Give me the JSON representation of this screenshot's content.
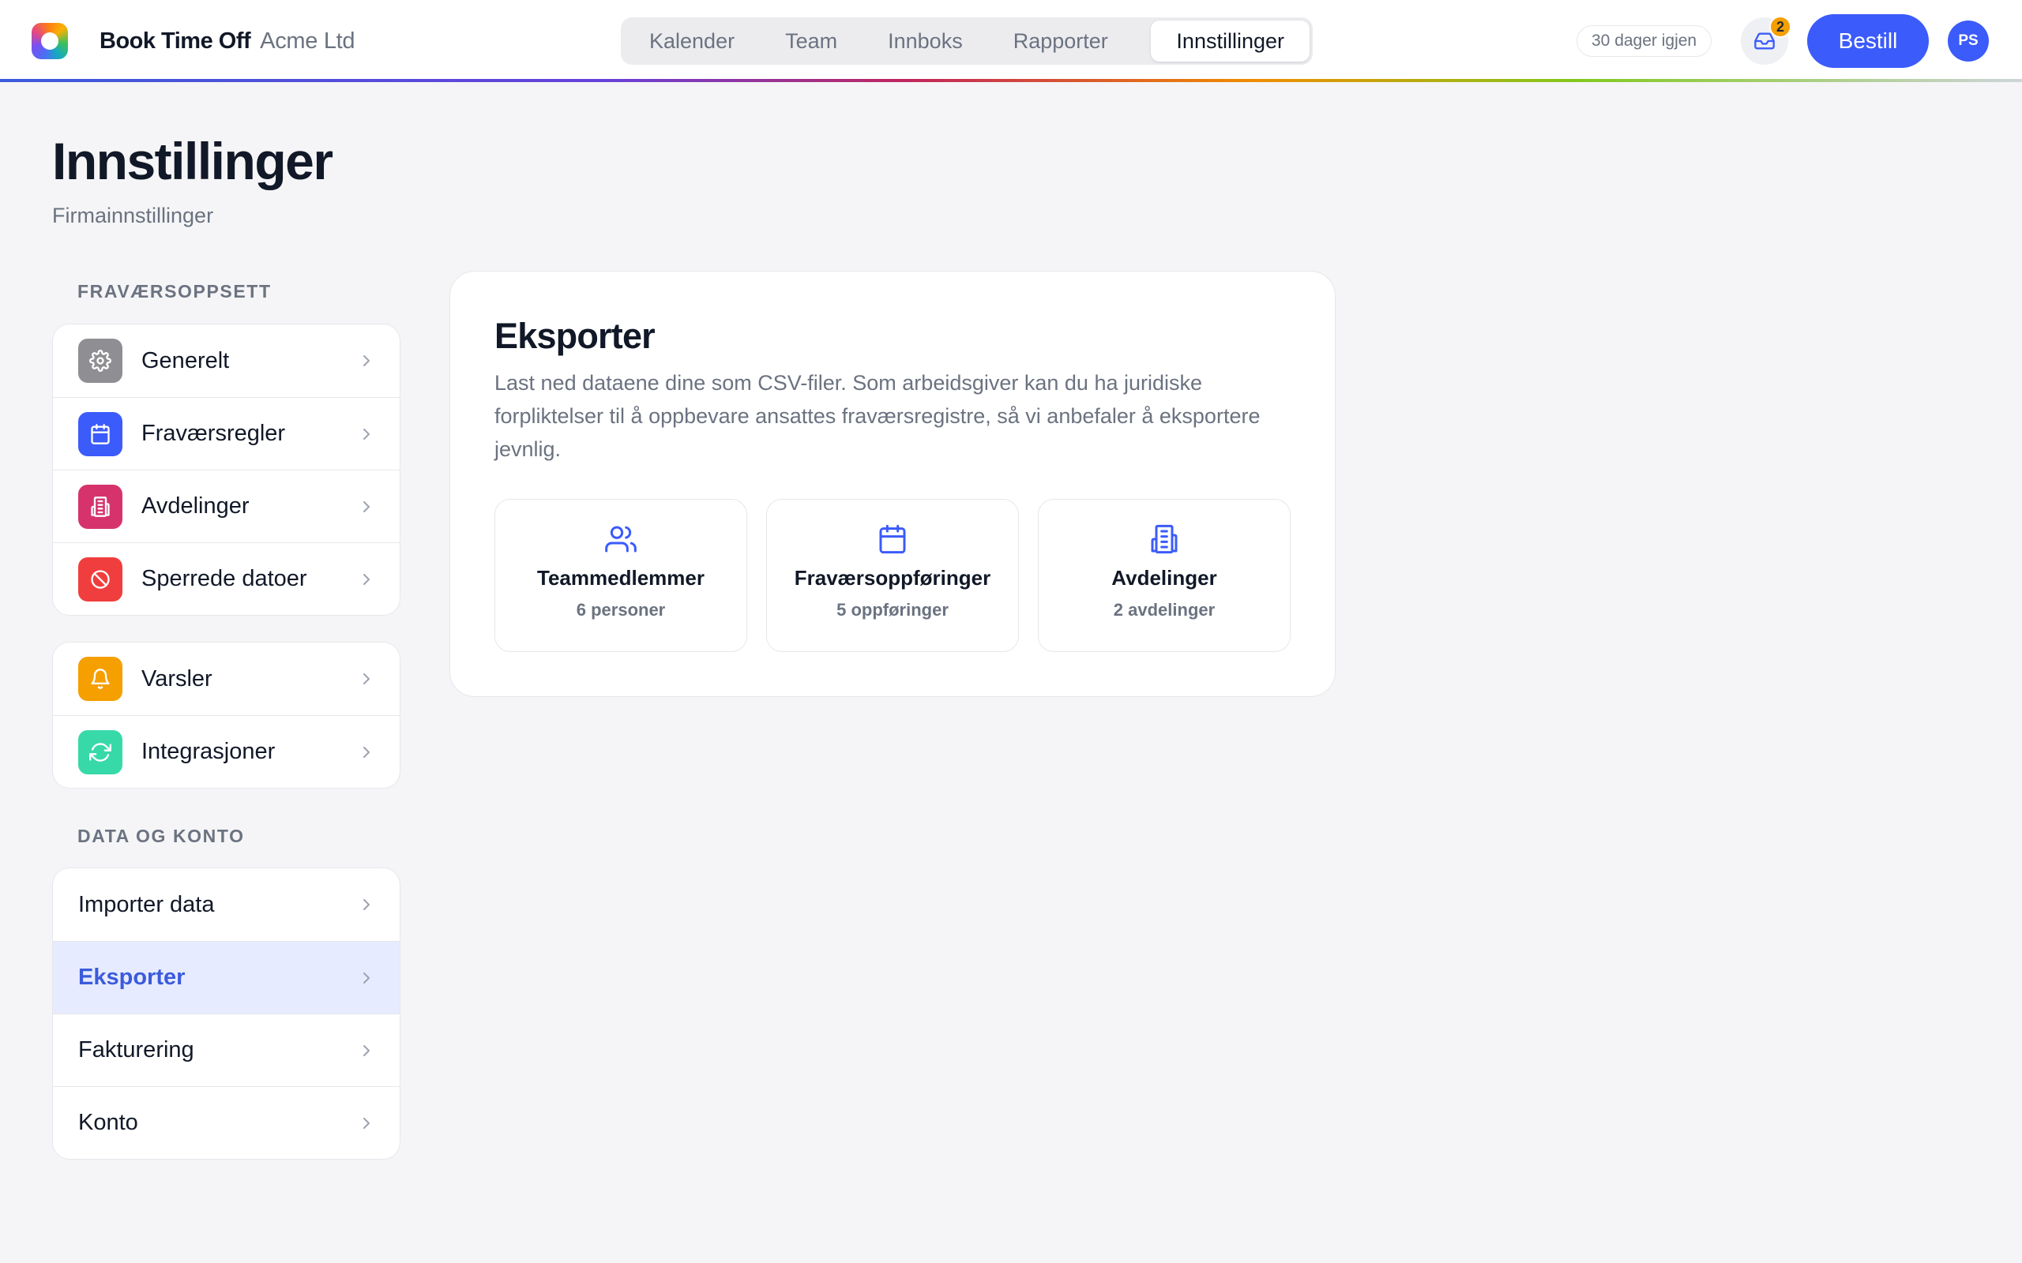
{
  "app": {
    "name": "Book Time Off",
    "company": "Acme Ltd"
  },
  "nav": {
    "tabs": [
      {
        "label": "Kalender"
      },
      {
        "label": "Team"
      },
      {
        "label": "Innboks"
      },
      {
        "label": "Rapporter"
      },
      {
        "label": "Innstillinger",
        "active": true
      }
    ]
  },
  "topbar": {
    "trial_text": "30 dager igjen",
    "inbox_count": "2",
    "order_label": "Bestill",
    "avatar_initials": "PS"
  },
  "page": {
    "title": "Innstillinger",
    "subtitle": "Firmainnstillinger"
  },
  "sidebar": {
    "section1_label": "FRAVÆRSOPPSETT",
    "group1": [
      {
        "label": "Generelt",
        "icon": "gear-icon",
        "color": "#8e8e93"
      },
      {
        "label": "Fraværsregler",
        "icon": "calendar-icon",
        "color": "#3b5bfb"
      },
      {
        "label": "Avdelinger",
        "icon": "building-icon",
        "color": "#d6336c"
      },
      {
        "label": "Sperrede datoer",
        "icon": "block-icon",
        "color": "#f03e3e"
      }
    ],
    "group2": [
      {
        "label": "Varsler",
        "icon": "bell-icon",
        "color": "#f59f00"
      },
      {
        "label": "Integrasjoner",
        "icon": "sync-icon",
        "color": "#38d9a9"
      }
    ],
    "section2_label": "DATA OG KONTO",
    "group3": [
      {
        "label": "Importer data"
      },
      {
        "label": "Eksporter",
        "active": true
      },
      {
        "label": "Fakturering"
      },
      {
        "label": "Konto"
      }
    ]
  },
  "export": {
    "title": "Eksporter",
    "description": "Last ned dataene dine som CSV-filer. Som arbeidsgiver kan du ha juridiske forpliktelser til å oppbevare ansattes fraværsregistre, så vi anbefaler å eksportere jevnlig.",
    "tiles": [
      {
        "title": "Teammedlemmer",
        "subtitle": "6 personer",
        "icon": "users-icon"
      },
      {
        "title": "Fraværsoppføringer",
        "subtitle": "5 oppføringer",
        "icon": "calendar-icon"
      },
      {
        "title": "Avdelinger",
        "subtitle": "2 avdelinger",
        "icon": "building-icon"
      }
    ]
  },
  "colors": {
    "accent": "#3b5bfb",
    "active_bg": "#e7ebff",
    "badge": "#f59f00"
  }
}
